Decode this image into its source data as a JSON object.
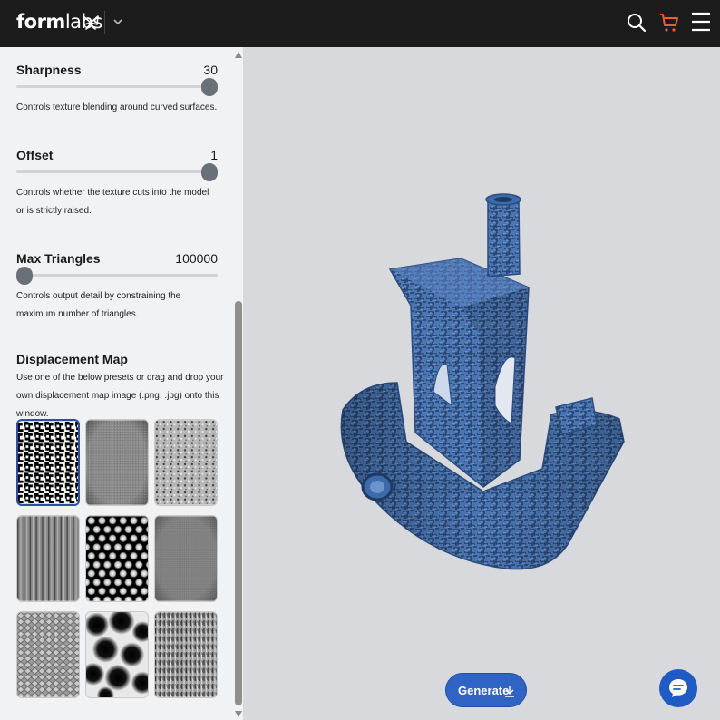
{
  "header": {
    "logo_bold": "form",
    "logo_light": "labs",
    "icons": [
      "butterfly-logo-icon",
      "chevron-down-icon",
      "search-icon",
      "cart-icon",
      "menu-icon"
    ]
  },
  "settings": {
    "sharpness": {
      "label": "Sharpness",
      "value": "30",
      "description": "Controls texture blending around curved surfaces.",
      "level": 1.0
    },
    "offset": {
      "label": "Offset",
      "value": "1",
      "description": "Controls whether the texture cuts into the model or is strictly raised.",
      "level": 1.0
    },
    "max_triangles": {
      "label": "Max Triangles",
      "value": "100000",
      "description": "Controls output detail by constraining the maximum number of triangles.",
      "level": 0.0
    }
  },
  "displacement": {
    "title": "Displacement Map",
    "description": "Use one of the below presets or drag and drop your own displacement map image (.png, .jpg) onto this window.",
    "presets": [
      "noise",
      "fine-grain",
      "speckle",
      "wood",
      "hex-dots",
      "smooth-grain",
      "knurl",
      "cells",
      "bark"
    ],
    "selected_index": 0
  },
  "viewport": {
    "generate_label": "Generate",
    "model_color": "#4a76b3"
  },
  "colors": {
    "topbar": "#1c1c1c",
    "accent_cart": "#e8602c",
    "primary": "#2f63c4"
  }
}
